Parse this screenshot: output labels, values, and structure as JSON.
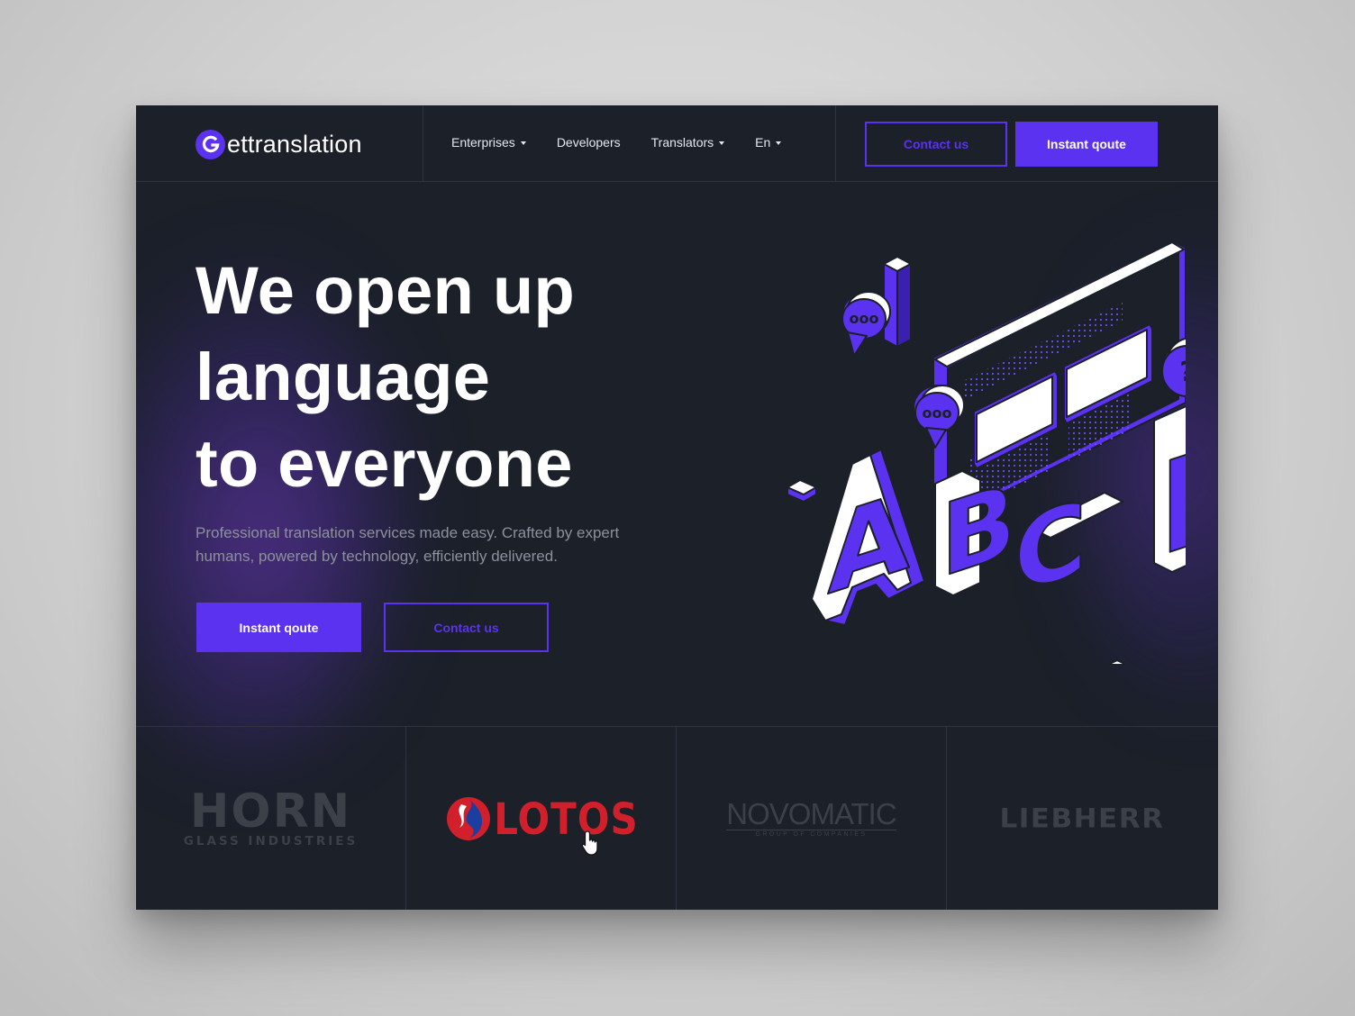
{
  "brand": {
    "logo_letter": "G",
    "logo_rest": "ettranslation"
  },
  "nav": {
    "items": [
      {
        "label": "Enterprises",
        "has_dropdown": true
      },
      {
        "label": "Developers",
        "has_dropdown": false
      },
      {
        "label": "Translators",
        "has_dropdown": true
      },
      {
        "label": "En",
        "has_dropdown": true
      }
    ]
  },
  "header_actions": {
    "contact_label": "Contact us",
    "quote_label": "Instant qoute"
  },
  "hero": {
    "headline_lines": [
      "We open up",
      "language",
      "to everyone"
    ],
    "subtitle_line1": "Professional translation services made easy. Crafted by expert",
    "subtitle_line2": "humans, powered by technology, efficiently delivered.",
    "primary_cta": "Instant qoute",
    "secondary_cta": "Contact us",
    "illustration_letters": [
      "A",
      "B",
      "C",
      "D"
    ],
    "bubble_dots": "ooo",
    "bubble_question": "?"
  },
  "clients": {
    "horn_main": "HORN",
    "horn_sub": "GLASS INDUSTRIES",
    "lotos": "LOTOS",
    "novomatic_main": "NOVOMATIC",
    "novomatic_sub": "GROUP OF COMPANIES",
    "liebherr": "LIEBHERR"
  },
  "colors": {
    "accent": "#5b32f0",
    "background": "#1b2029",
    "text": "#ffffff",
    "muted_text": "#8c919c",
    "logo_gray": "#3b4049",
    "lotos_red": "#d1202c"
  }
}
